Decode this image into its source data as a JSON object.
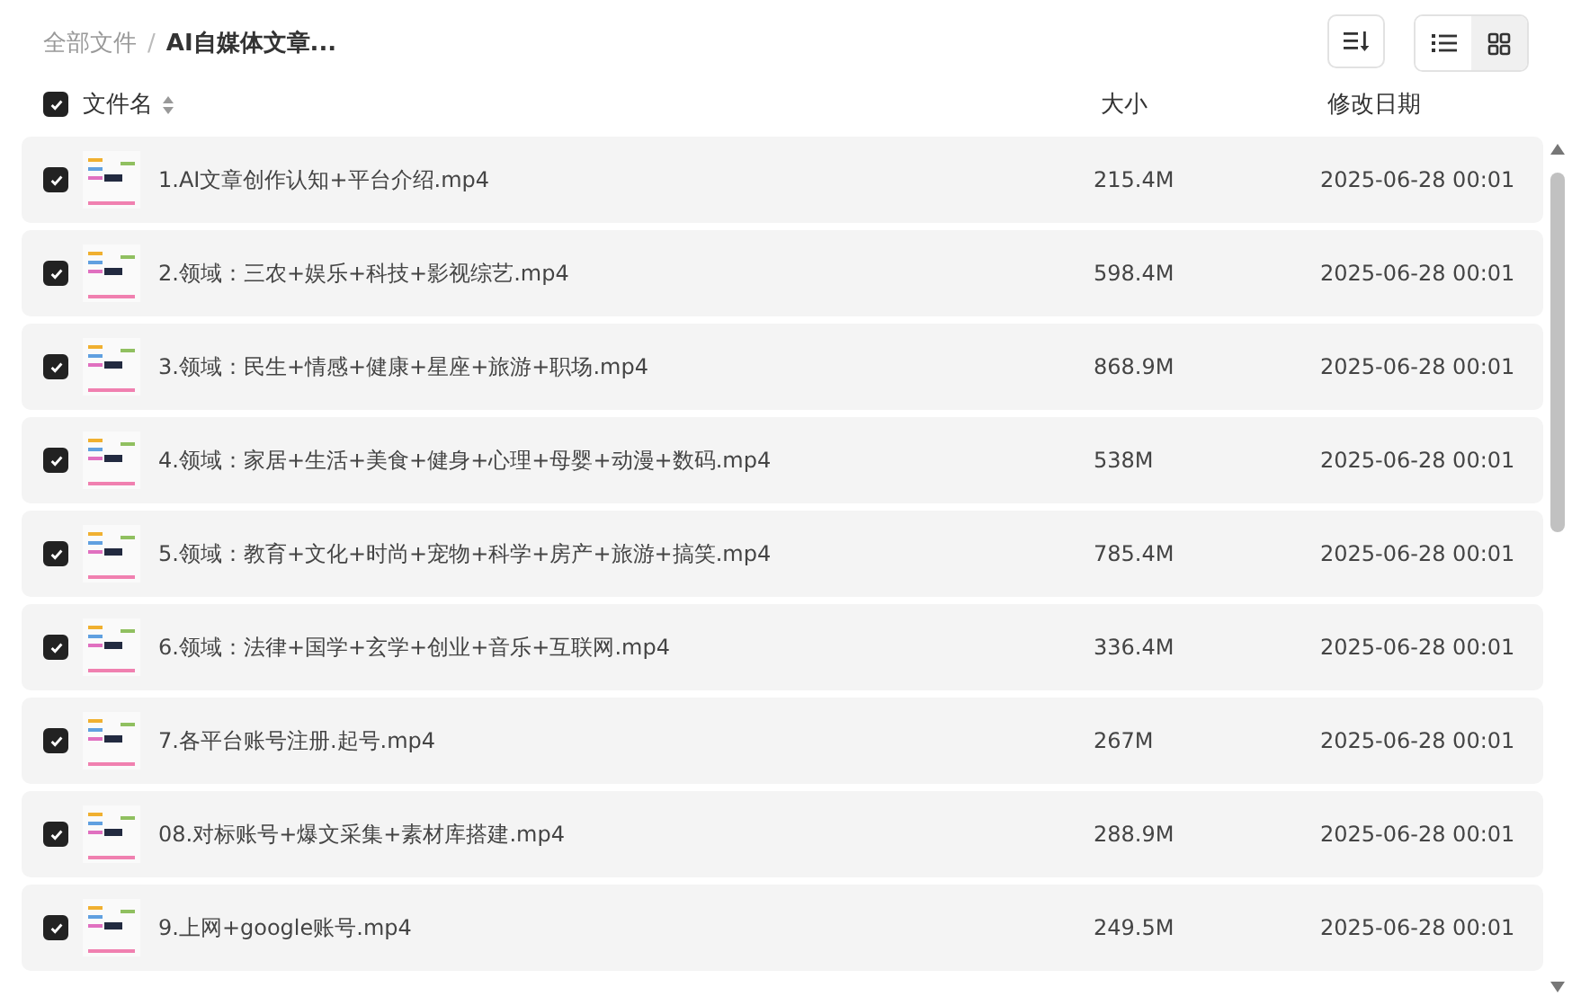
{
  "breadcrumb_separator": "/",
  "breadcrumb": [
    {
      "label": "全部文件",
      "current": false
    },
    {
      "label": "AI自媒体文章...",
      "current": true
    }
  ],
  "view_toggle": [
    {
      "kind": "list",
      "selected": true
    },
    {
      "kind": "grid",
      "selected": false
    }
  ],
  "table": {
    "select_all": {
      "checked": true
    },
    "columns": [
      "文件名",
      "大小",
      "修改日期"
    ],
    "rows": [
      {
        "name": "1.AI文章创作认知+平台介绍.mp4",
        "size": "215.4M",
        "modified": "2025-06-28 00:01",
        "checked": true
      },
      {
        "name": "2.领域：三农+娱乐+科技+影视综艺.mp4",
        "size": "598.4M",
        "modified": "2025-06-28 00:01",
        "checked": true
      },
      {
        "name": "3.领域：民生+情感+健康+星座+旅游+职场.mp4",
        "size": "868.9M",
        "modified": "2025-06-28 00:01",
        "checked": true
      },
      {
        "name": "4.领域：家居+生活+美食+健身+心理+母婴+动漫+数码.mp4",
        "size": "538M",
        "modified": "2025-06-28 00:01",
        "checked": true
      },
      {
        "name": "5.领域：教育+文化+时尚+宠物+科学+房产+旅游+搞笑.mp4",
        "size": "785.4M",
        "modified": "2025-06-28 00:01",
        "checked": true
      },
      {
        "name": "6.领域：法律+国学+玄学+创业+音乐+互联网.mp4",
        "size": "336.4M",
        "modified": "2025-06-28 00:01",
        "checked": true
      },
      {
        "name": "7.各平台账号注册.起号.mp4",
        "size": "267M",
        "modified": "2025-06-28 00:01",
        "checked": true
      },
      {
        "name": "08.对标账号+爆文采集+素材库搭建.mp4",
        "size": "288.9M",
        "modified": "2025-06-28 00:01",
        "checked": true
      },
      {
        "name": "9.上网+google账号.mp4",
        "size": "249.5M",
        "modified": "2025-06-28 00:01",
        "checked": true
      }
    ]
  }
}
